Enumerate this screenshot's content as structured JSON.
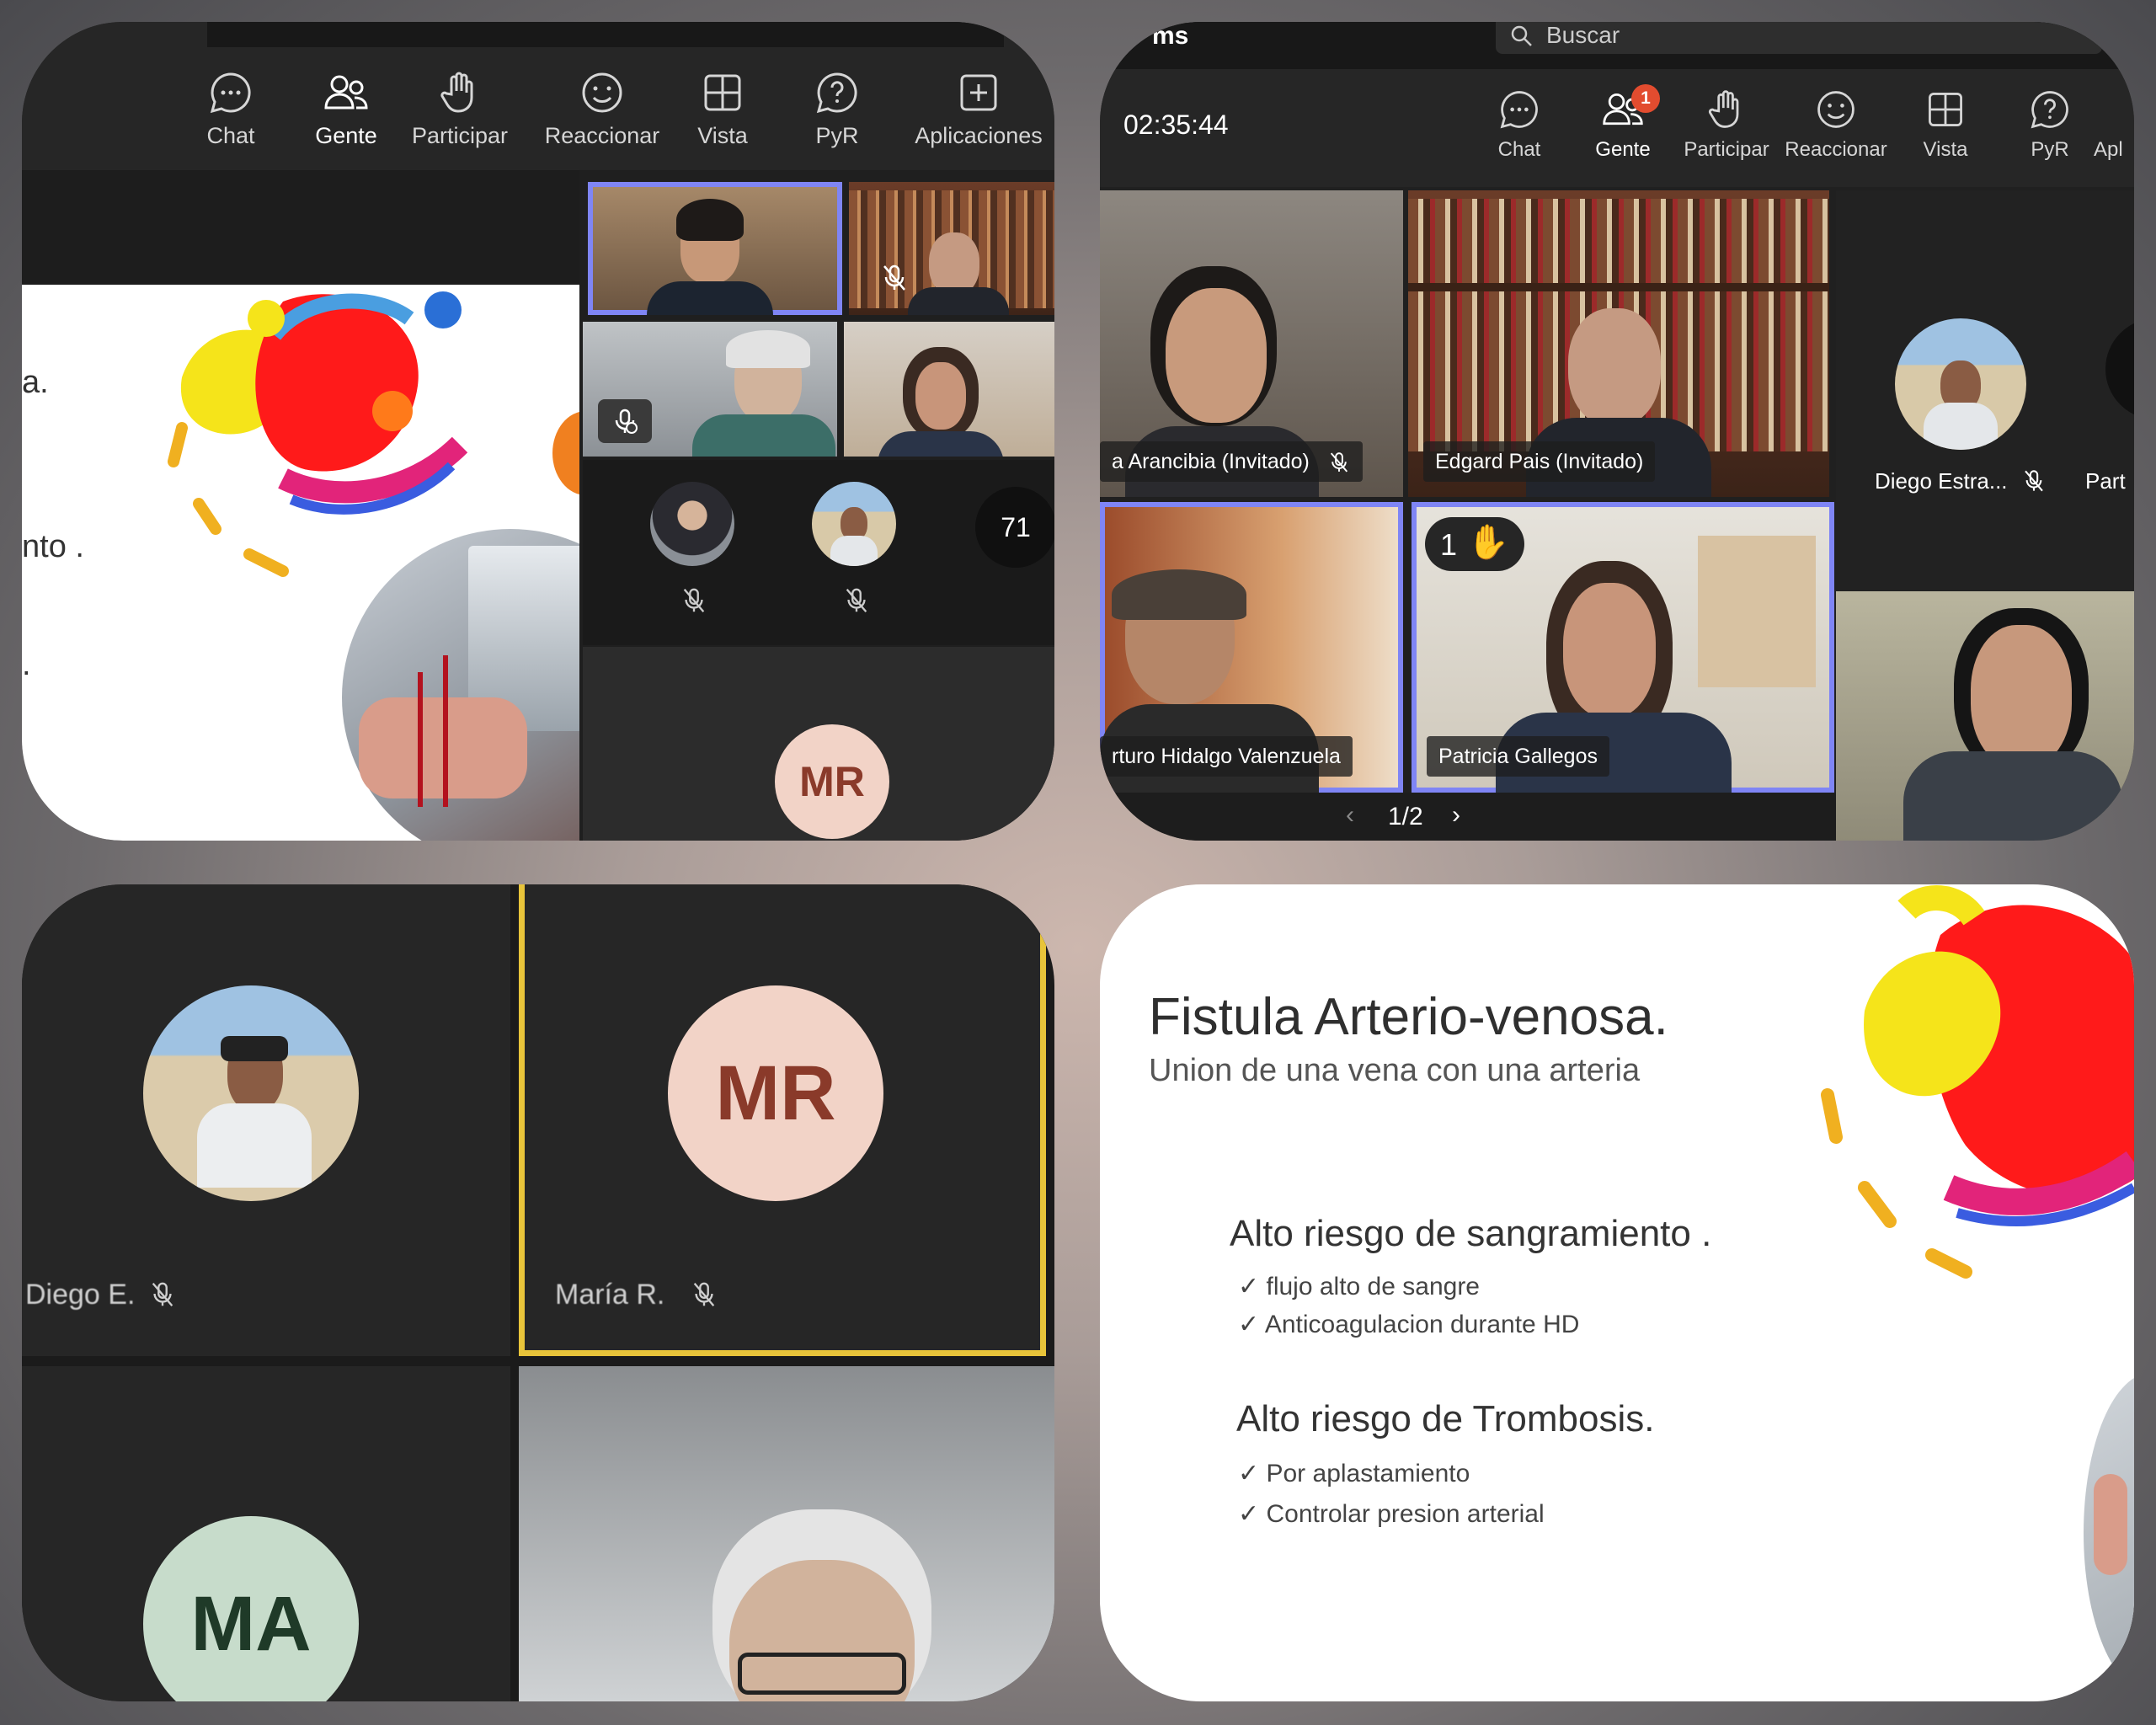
{
  "toolbar": {
    "chat": "Chat",
    "people": "Gente",
    "participate": "Participar",
    "react": "Reaccionar",
    "view": "Vista",
    "qa": "PyR",
    "apps": "Aplicaciones",
    "apps_cut": "Apl",
    "people_badge": "1"
  },
  "panel1": {
    "slide_fragments": [
      "a.",
      "nto .",
      "."
    ],
    "more_count": "71",
    "avatar_initials": "MR"
  },
  "panel2": {
    "app_title_cut": "ms",
    "search_placeholder": "Buscar",
    "timer": "02:35:44",
    "participants": [
      "a Arancibia (Invitado)",
      "Edgard Pais (Invitado)",
      "Diego Estra...",
      "Part",
      "rturo Hidalgo Valenzuela",
      "Patricia Gallegos"
    ],
    "raised_hand_count": "1",
    "page_indicator": "1/2"
  },
  "panel3": {
    "tiles": [
      {
        "name": "Diego E."
      },
      {
        "name": "María R.",
        "initials": "MR"
      },
      {
        "name": "",
        "initials": "MA"
      }
    ]
  },
  "panel4": {
    "title": "Fistula Arterio-venosa.",
    "subtitle": "Union de una vena con una arteria",
    "sections": [
      {
        "heading": "Alto riesgo de sangramiento .",
        "bullets": [
          "flujo alto de sangre",
          "Anticoagulacion durante HD"
        ]
      },
      {
        "heading": "Alto riesgo de Trombosis.",
        "bullets": [
          "Por aplastamiento",
          "Controlar presion arterial"
        ]
      }
    ]
  },
  "colors": {
    "accent": "#7f85f5",
    "speaker_border": "#e8c43a",
    "badge": "#e24c2f",
    "mr_avatar": "#f2d3c7",
    "ma_avatar": "#c7dccb"
  }
}
